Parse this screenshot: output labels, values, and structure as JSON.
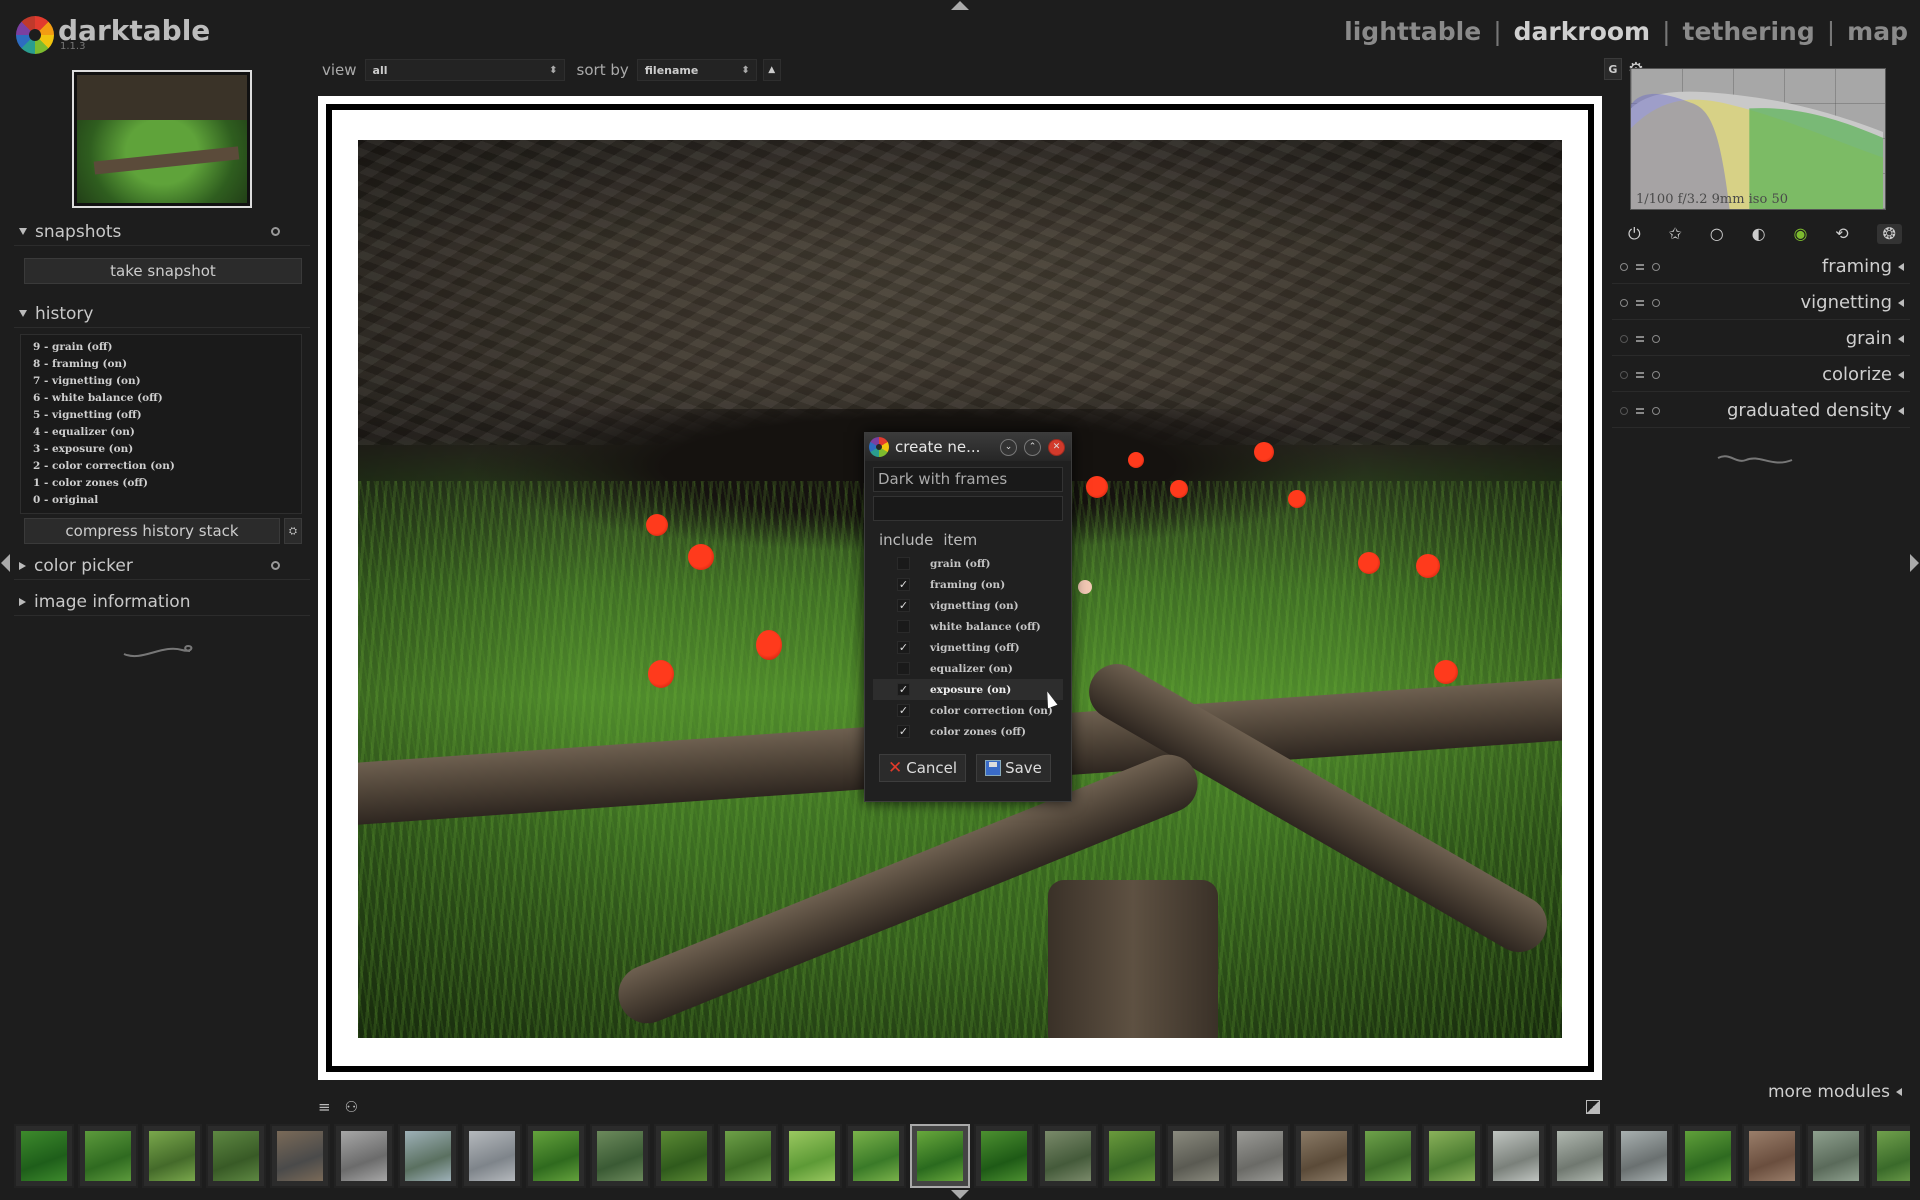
{
  "app": {
    "name": "darktable",
    "version": "1.1.3"
  },
  "views": [
    "lighttable",
    "darkroom",
    "tethering",
    "map"
  ],
  "active_view": "darkroom",
  "toolbar": {
    "view_label": "view",
    "view_value": "all",
    "sort_label": "sort by",
    "sort_value": "filename",
    "sort_dir_icon": "▲",
    "grouping_label": "G"
  },
  "left_panel": {
    "snapshots": {
      "title": "snapshots",
      "button": "take snapshot"
    },
    "history": {
      "title": "history",
      "items": [
        "9 - grain (off)",
        "8 - framing (on)",
        "7 - vignetting (on)",
        "6 - white balance (off)",
        "5 - vignetting (off)",
        "4 - equalizer (on)",
        "3 - exposure (on)",
        "2 - color correction (on)",
        "1 - color zones (off)",
        "0 - original"
      ],
      "compress_button": "compress history stack"
    },
    "color_picker": {
      "title": "color picker"
    },
    "image_information": {
      "title": "image information"
    }
  },
  "dialog": {
    "title": "create ne...",
    "name_value": "Dark with frames",
    "description_value": "",
    "col_include": "include",
    "col_item": "item",
    "items": [
      {
        "label": "grain (off)",
        "checked": false
      },
      {
        "label": "framing (on)",
        "checked": true
      },
      {
        "label": "vignetting (on)",
        "checked": true
      },
      {
        "label": "white balance (off)",
        "checked": false
      },
      {
        "label": "vignetting (off)",
        "checked": true
      },
      {
        "label": "equalizer (on)",
        "checked": false
      },
      {
        "label": "exposure (on)",
        "checked": true
      },
      {
        "label": "color correction (on)",
        "checked": true
      },
      {
        "label": "color zones (off)",
        "checked": true
      }
    ],
    "selected_index": 6,
    "cancel_label": "Cancel",
    "save_label": "Save",
    "check_glyph": "✓"
  },
  "right_panel": {
    "histogram_info": "1/100 f/3.2 9mm iso 50",
    "module_group_icons": [
      "power-icon",
      "star-icon",
      "circle-icon",
      "tone-icon",
      "color-icon",
      "correct-icon",
      "effect-icon"
    ],
    "modules": [
      "framing",
      "vignetting",
      "grain",
      "colorize",
      "graduated density"
    ],
    "more_modules": "more modules"
  },
  "filmstrip": {
    "count": 30,
    "current_index": 14
  },
  "colors": {
    "background": "#1d1d1d",
    "close_button": "#d23a2b",
    "poppy_red": "#ff3a1c",
    "grass_green": "#4f8a2c"
  }
}
